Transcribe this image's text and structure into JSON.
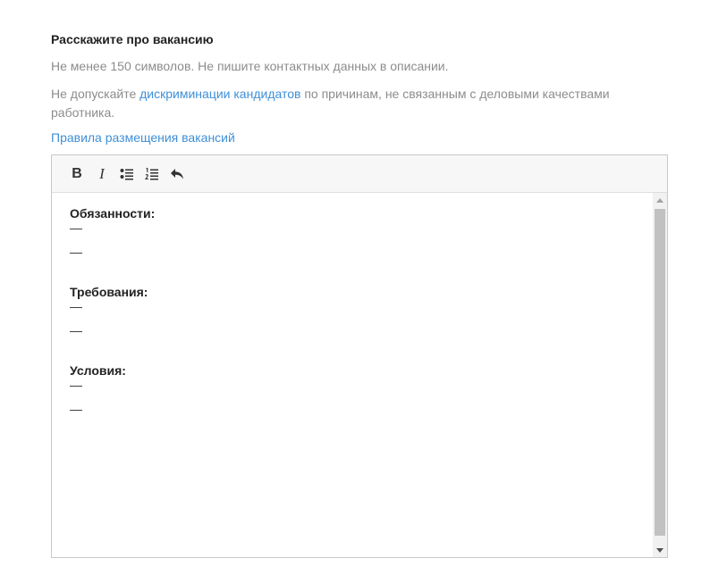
{
  "form": {
    "title": "Расскажите про вакансию",
    "hint_min_chars": "Не менее 150 символов. Не пишите контактных данных в описании.",
    "hint_discrimination_prefix": "Не допускайте ",
    "hint_discrimination_link": "дискриминации кандидатов",
    "hint_discrimination_suffix": " по причинам, не связанным с деловыми качествами работника.",
    "rules_link": "Правила размещения вакансий"
  },
  "toolbar": {
    "bold_label": "B",
    "italic_label": "I",
    "icons": [
      "bullet-list-icon",
      "numbered-list-icon",
      "undo-icon"
    ]
  },
  "editor": {
    "sections": [
      {
        "title": "Обязанности:",
        "items": [
          "—",
          "—"
        ]
      },
      {
        "title": "Требования:",
        "items": [
          "—",
          "—"
        ]
      },
      {
        "title": "Условия:",
        "items": [
          "—",
          "—"
        ]
      }
    ]
  },
  "colors": {
    "link": "#3f8fd8",
    "hint": "#8c8c8c",
    "toolbar_bg": "#f7f7f7",
    "scroll_thumb": "#c1c1c1"
  }
}
